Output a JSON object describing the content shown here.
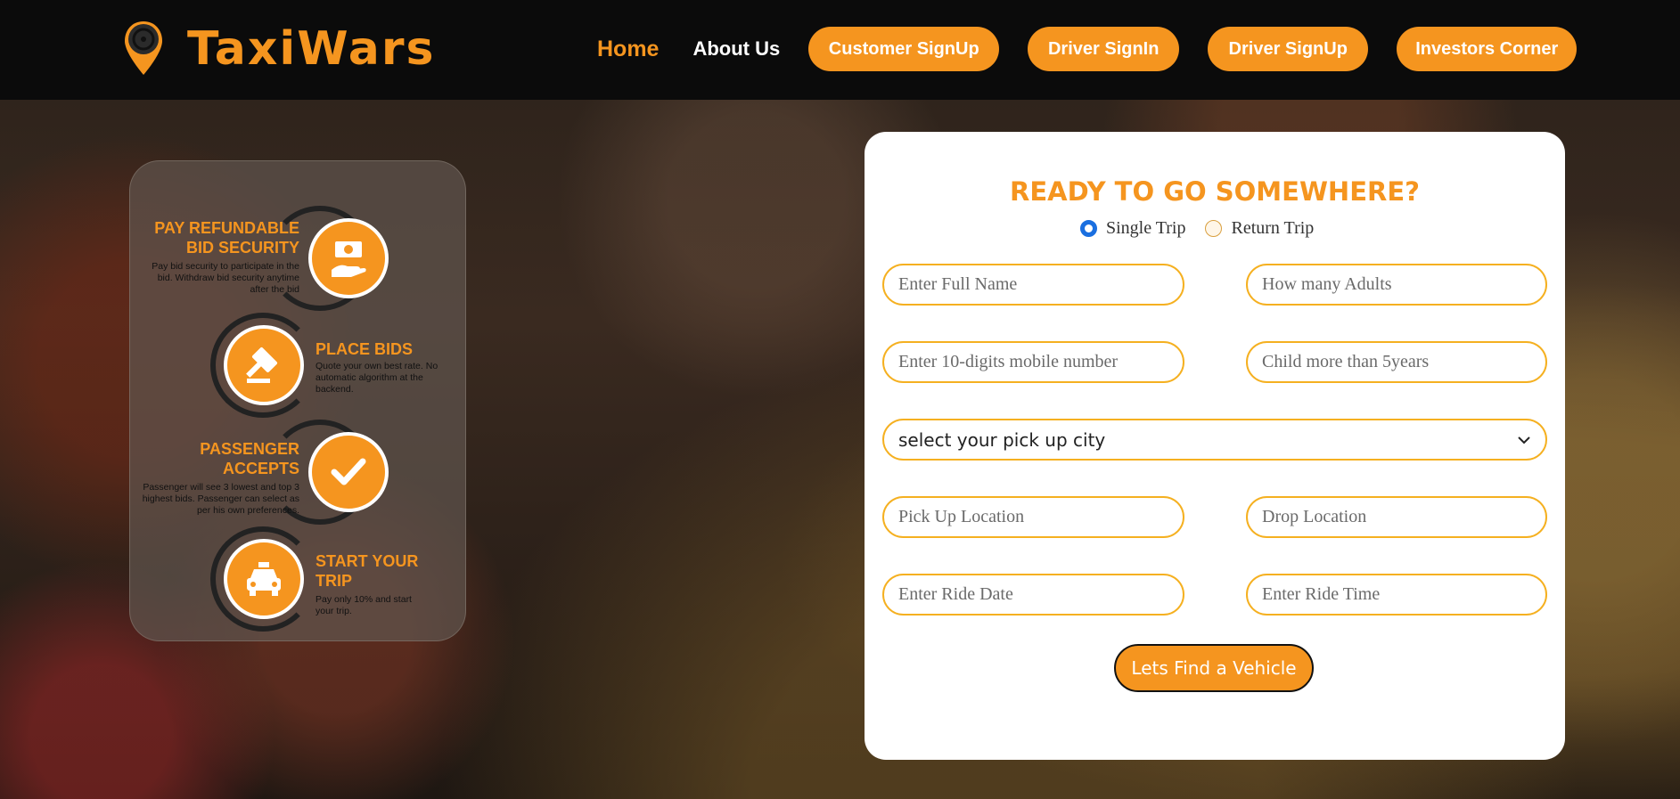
{
  "brand": {
    "name": "TaxiWars",
    "accent": "#f5951f"
  },
  "nav": {
    "home": "Home",
    "about": "About Us",
    "buttons": [
      "Customer SignUp",
      "Driver SignIn",
      "Driver SignUp",
      "Investors Corner"
    ]
  },
  "steps": [
    {
      "title": "PAY REFUNDABLE BID SECURITY",
      "desc": "Pay bid security to participate in the bid. Withdraw bid security anytime after the bid",
      "icon": "money-hand-icon"
    },
    {
      "title": "PLACE BIDS",
      "desc": "Quote your own best rate. No automatic algorithm at the backend.",
      "icon": "gavel-icon"
    },
    {
      "title": "PASSENGER ACCEPTS",
      "desc": "Passenger will see 3 lowest and top 3 highest bids. Passenger can select as per his own preferences.",
      "icon": "check-icon"
    },
    {
      "title": "START YOUR TRIP",
      "desc": "Pay only 10% and start your trip.",
      "icon": "taxi-icon"
    }
  ],
  "form": {
    "heading": "READY TO GO SOMEWHERE?",
    "trip_types": [
      "Single Trip",
      "Return Trip"
    ],
    "selected_trip": "Single Trip",
    "placeholders": {
      "full_name": "Enter Full Name",
      "adults": "How many Adults",
      "mobile": "Enter 10-digits mobile number",
      "children": "Child more than 5years",
      "pickup": "Pick Up Location",
      "drop": "Drop Location",
      "date": "Enter Ride Date",
      "time": "Enter Ride Time"
    },
    "city_select": "select your pick up city",
    "submit": "Lets Find a Vehicle"
  }
}
